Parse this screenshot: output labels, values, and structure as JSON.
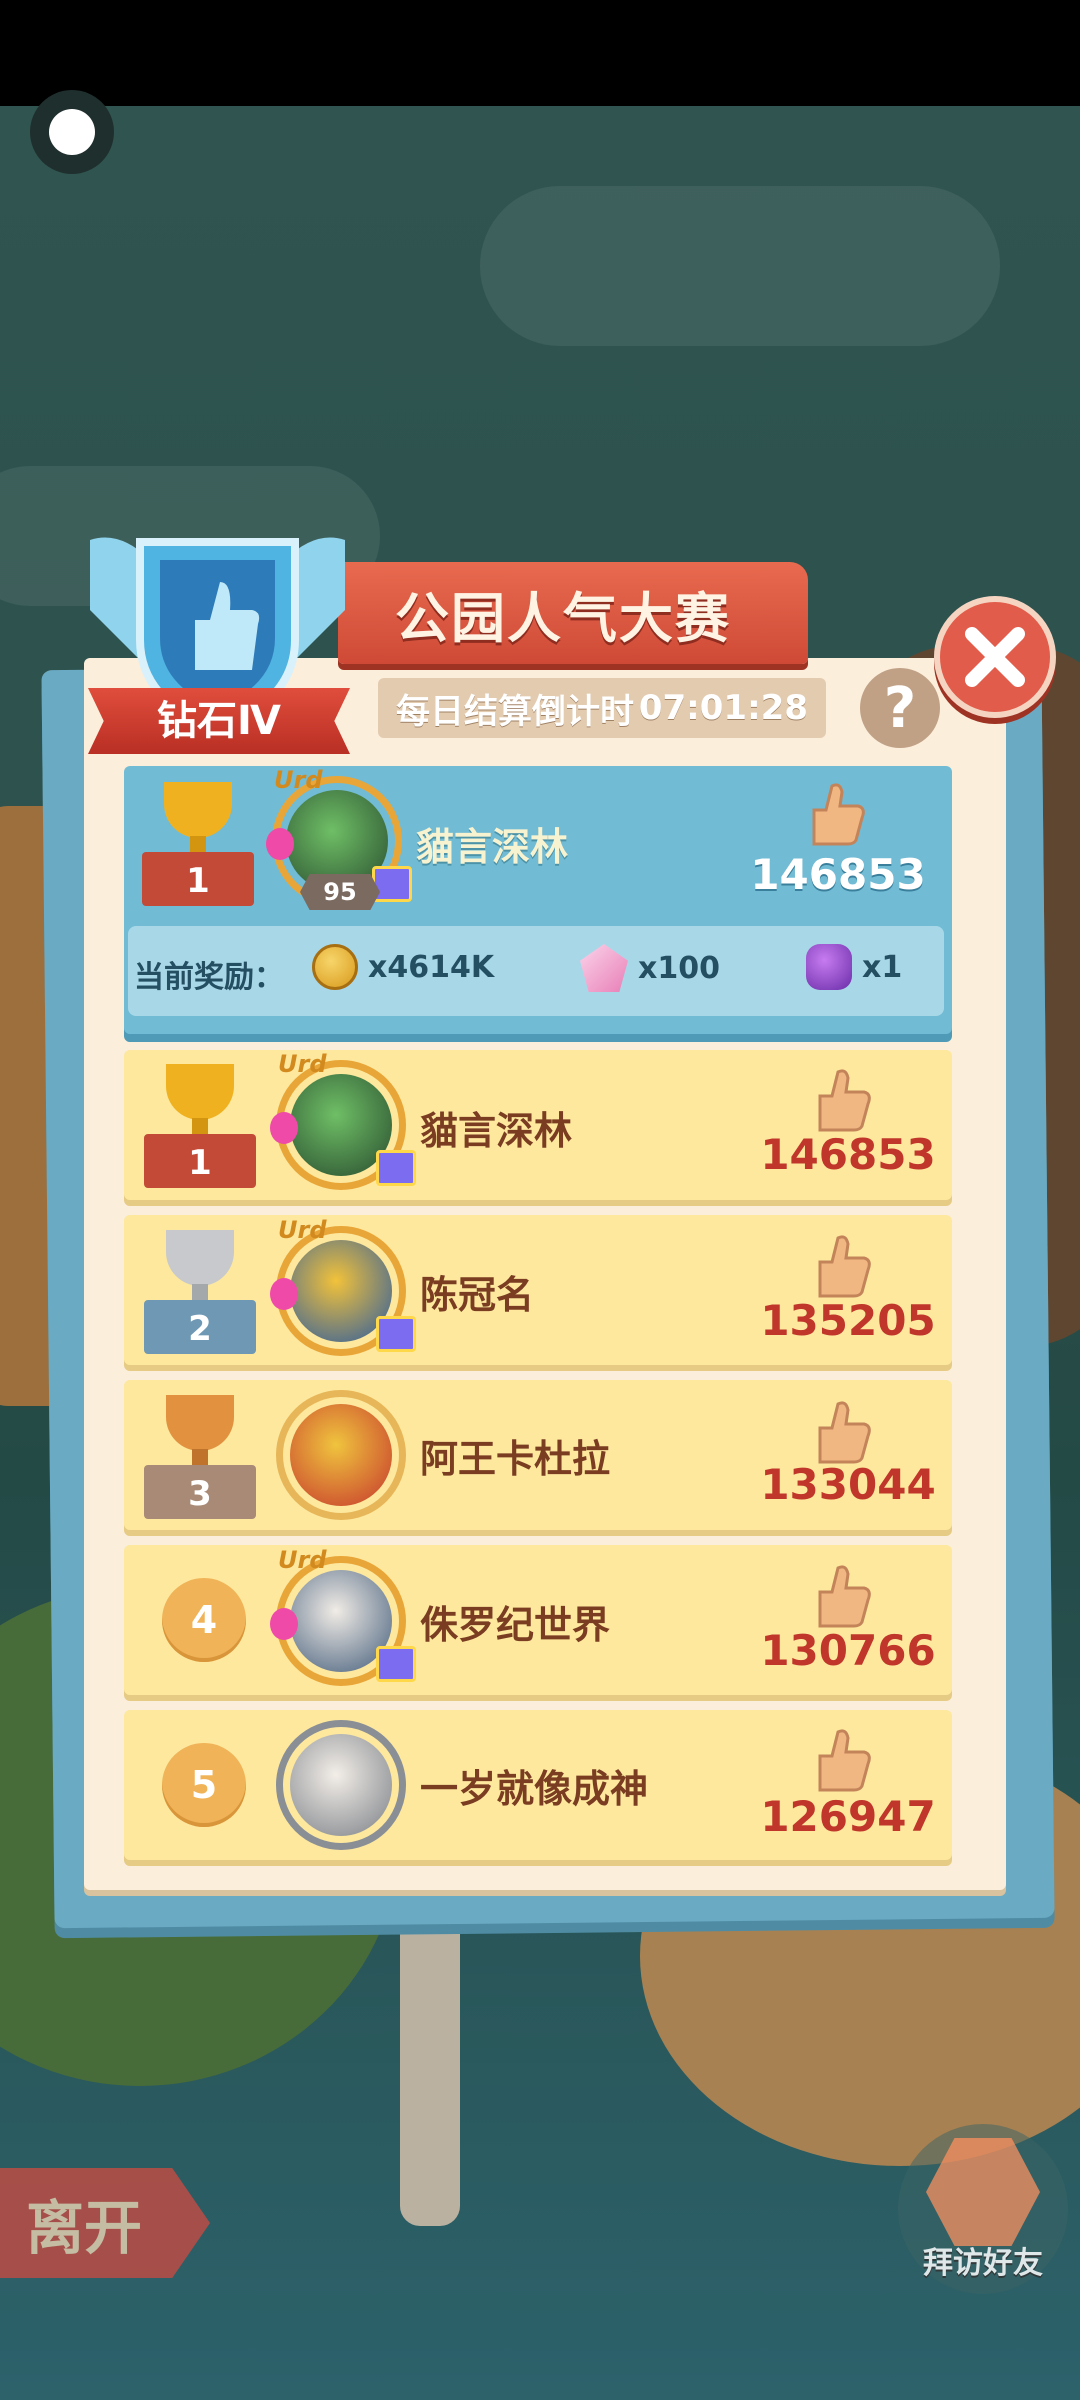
{
  "title": "公园人气大赛",
  "rank_badge": "钻石Ⅳ",
  "countdown": {
    "label": "每日结算倒计时",
    "time": "07:01:28"
  },
  "help_label": "?",
  "my_entry": {
    "rank": "1",
    "name": "貓言深林",
    "level": "95",
    "score": "146853",
    "rewards_label": "当前奖励：",
    "rewards": [
      {
        "icon": "coin-icon",
        "amount": "x4614K"
      },
      {
        "icon": "gem-icon",
        "amount": "x100"
      },
      {
        "icon": "orb-icon",
        "amount": "x1"
      }
    ]
  },
  "leaderboard": [
    {
      "rank": "1",
      "name": "貓言深林",
      "score": "146853",
      "medal": "gold"
    },
    {
      "rank": "2",
      "name": "陈冠名",
      "score": "135205",
      "medal": "silver"
    },
    {
      "rank": "3",
      "name": "阿王卡杜拉",
      "score": "133044",
      "medal": "bronze"
    },
    {
      "rank": "4",
      "name": "侏罗纪世界",
      "score": "130766",
      "medal": "none"
    },
    {
      "rank": "5",
      "name": "一岁就像成神",
      "score": "126947",
      "medal": "none"
    }
  ],
  "leave_label": "离开",
  "visit_label": "拜访好友",
  "colors": {
    "gold": "#f0b120",
    "silver": "#c7c9cc",
    "bronze": "#e2913f",
    "score": "#c0362a",
    "accent": "#e25c4b"
  }
}
